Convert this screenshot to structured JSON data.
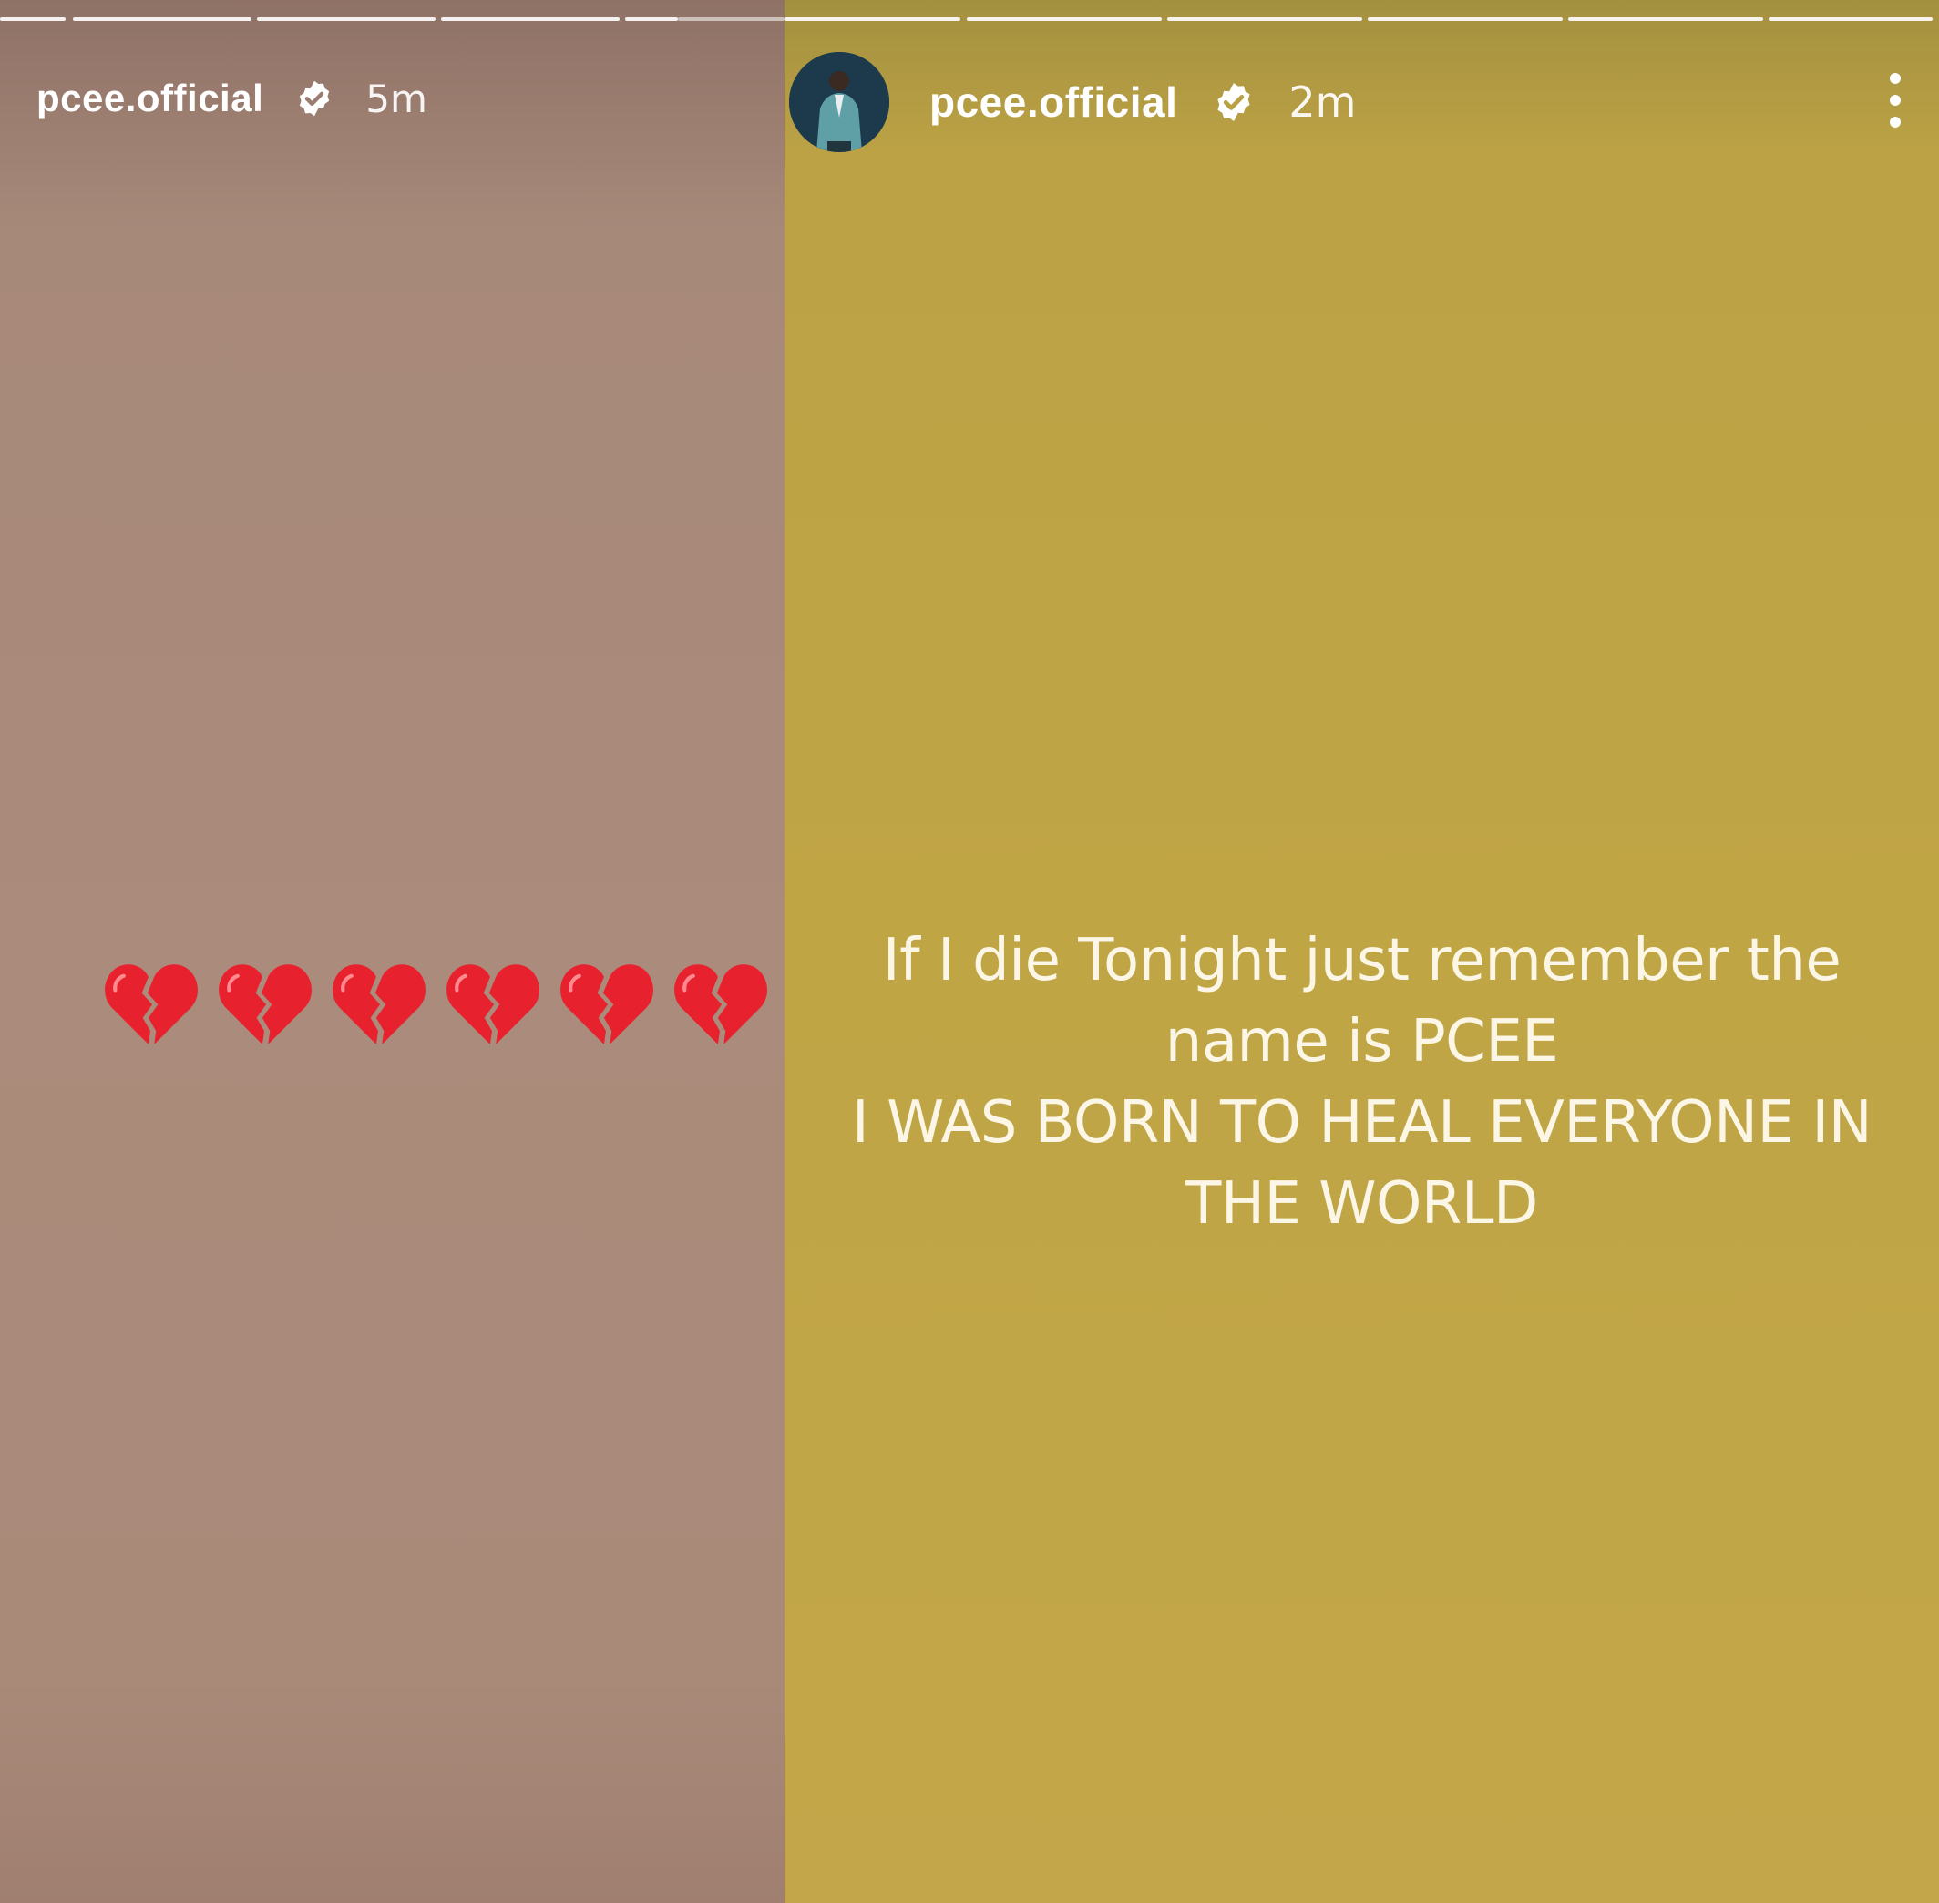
{
  "left_story": {
    "username": "pcee.official",
    "timestamp": "5m",
    "emoji": "💔",
    "emoji_count": 6,
    "background_color": "#ab8b7b"
  },
  "right_story": {
    "username": "pcee.official",
    "timestamp": "2m",
    "caption_lines": [
      "If I die Tonight just remember the",
      "name is PCEE",
      "I WAS BORN TO HEAL EVERYONE IN",
      "THE WORLD"
    ],
    "background_color": "#c0a545"
  },
  "icons": {
    "verified": "verified-badge-icon",
    "more": "more-vertical-icon",
    "emoji": "broken-heart-icon"
  },
  "colors": {
    "badge_fill": "#ffffff",
    "heart": "#e8212f",
    "caption_text": "#fbf6e6"
  }
}
